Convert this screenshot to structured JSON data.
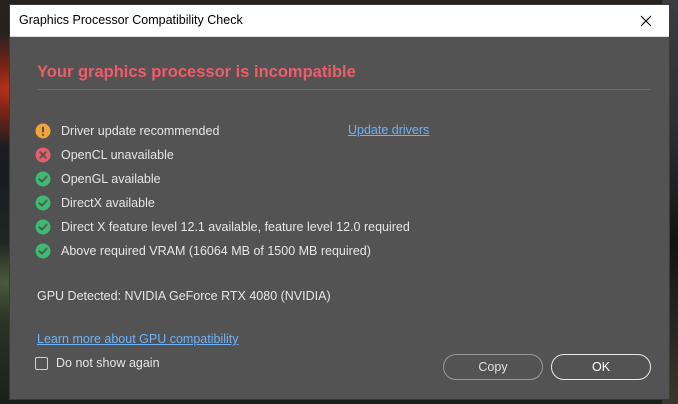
{
  "window": {
    "title": "Graphics Processor Compatibility Check"
  },
  "main": {
    "heading": "Your graphics processor is incompatible",
    "checks": [
      {
        "status": "warning",
        "icon": "warning-icon",
        "text": "Driver update recommended"
      },
      {
        "status": "error",
        "icon": "error-icon",
        "text": "OpenCL unavailable"
      },
      {
        "status": "ok",
        "icon": "check-icon",
        "text": "OpenGL available"
      },
      {
        "status": "ok",
        "icon": "check-icon",
        "text": "DirectX available"
      },
      {
        "status": "ok",
        "icon": "check-icon",
        "text": "Direct X feature level 12.1 available, feature level 12.0 required"
      },
      {
        "status": "ok",
        "icon": "check-icon",
        "text": "Above required VRAM (16064 MB of 1500 MB required)"
      }
    ],
    "update_link": "Update drivers",
    "gpu_detected": "GPU Detected: NVIDIA GeForce RTX 4080 (NVIDIA)",
    "learn_more_link": "Learn more about GPU compatibility"
  },
  "footer": {
    "dont_show_label": "Do not show again",
    "dont_show_checked": false,
    "copy_label": "Copy",
    "ok_label": "OK"
  },
  "colors": {
    "heading": "#ef5c6a",
    "warning": "#f0a43a",
    "error": "#e4606a",
    "ok": "#3dba6f",
    "link": "#6eb3f7",
    "dialog_bg": "#535353"
  }
}
